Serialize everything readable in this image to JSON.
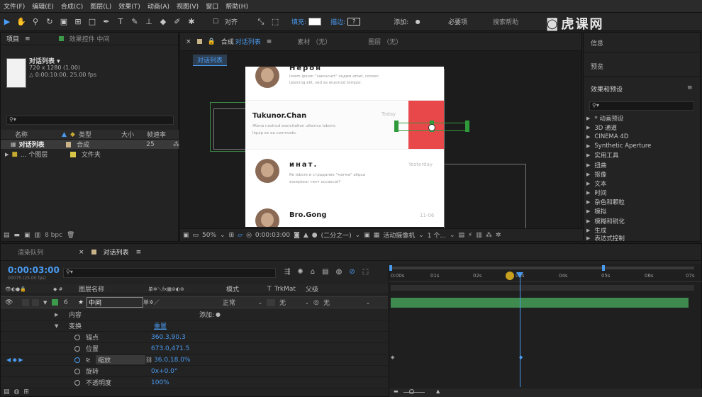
{
  "menu": [
    "文件(F)",
    "编辑(E)",
    "合成(C)",
    "图层(L)",
    "效果(T)",
    "动画(A)",
    "视图(V)",
    "窗口",
    "帮助(H)"
  ],
  "toolbar": {
    "align_label": "对齐",
    "fill_label": "填充:",
    "stroke_label": "描边:",
    "stroke_value": "?",
    "add_label": "添加:",
    "essentials_label": "必要项",
    "search_help": "搜索帮助"
  },
  "watermark": "虎课网",
  "project_panel": {
    "tab_project": "项目",
    "tab_effect_controls": "效果控件 中间",
    "comp_name": "对话列表 ▾",
    "comp_size": "720 x 1280 (1.00)",
    "comp_duration": "△ 0:00:10:00, 25.00 fps",
    "columns": [
      "名称",
      "类型",
      "大小",
      "帧速率"
    ],
    "items": [
      {
        "name": "对话列表",
        "type": "合成",
        "size": "",
        "fps": "25",
        "selected": true
      },
      {
        "name": "... 个图层",
        "type": "文件夹",
        "size": "",
        "fps": "",
        "selected": false
      }
    ],
    "bpc": "8 bpc"
  },
  "comp_panel": {
    "tab_label": "合成",
    "tab_name": "对话列表",
    "footage_tab": "素材 （无）",
    "layer_tab": "图层 （无）",
    "subtab": "对话列表",
    "zoom": "50%",
    "timecode": "0:00:03:00",
    "resolution": "(二分之一)",
    "camera": "活动摄像机",
    "views": "1 个...",
    "chat": [
      {
        "name": "Нерон",
        "time": "",
        "msg1": "lorem ipsum \"закончит\" седим amet, consec",
        "msg2": "ipisicing elit, sed as eiusmod tempor."
      },
      {
        "name": "Tukunor.Chan",
        "time": "Today",
        "msg1": "Жена nostrud exercitation ullamco laboris",
        "msg2": "liquip ex ea commodo."
      },
      {
        "name": "инат.",
        "time": "Yesterday",
        "msg1": "Re labore и страдание \"магма\" aliqua",
        "msg2": "excepteur тент occaecat?"
      },
      {
        "name": "Bro.Gong",
        "time": "11-06",
        "msg1": "",
        "msg2": ""
      }
    ]
  },
  "right_panel": {
    "info_label": "信息",
    "preview_label": "预览",
    "effects_label": "效果和预设",
    "effects": [
      "* 动画预设",
      "3D 通道",
      "CINEMA 4D",
      "Synthetic Aperture",
      "实用工具",
      "扭曲",
      "抠像",
      "文本",
      "时间",
      "杂色和颗粒",
      "模拟",
      "模糊和锐化",
      "生成",
      "表达式控制"
    ]
  },
  "timeline": {
    "tab_render": "渲染队列",
    "tab_comp": "对话列表",
    "timecode": "0:00:03:00",
    "timecode_sub": "00075 (25.00 fps)",
    "col_layer_name": "图层名称",
    "col_mode": "模式",
    "col_trkmat": "TrkMat",
    "col_parent": "父级",
    "layer_index": "6",
    "layer_name": "中间",
    "layer_mode": "正常",
    "layer_trkmat": "无",
    "layer_parent": "无",
    "contents_label": "内容",
    "add_label": "添加:",
    "transform_label": "变换",
    "reset_label": "重置",
    "properties": [
      {
        "name": "锚点",
        "value": "360.3,90.3"
      },
      {
        "name": "位置",
        "value": "673.0,471.5"
      },
      {
        "name": "缩放",
        "value": "36.0,18.0%"
      },
      {
        "name": "旋转",
        "value": "0x+0.0°"
      },
      {
        "name": "不透明度",
        "value": "100%"
      }
    ],
    "ruler": [
      "0:00s",
      "01s",
      "02s",
      "03s",
      "04s",
      "05s",
      "06s",
      "07s"
    ],
    "playhead_seconds": 3
  },
  "colors": {
    "accent_blue": "#4a9bf0",
    "layer_bar_green": "#3f8a4e",
    "selection_green": "#2f9a3a",
    "red_block": "#e8484a"
  }
}
